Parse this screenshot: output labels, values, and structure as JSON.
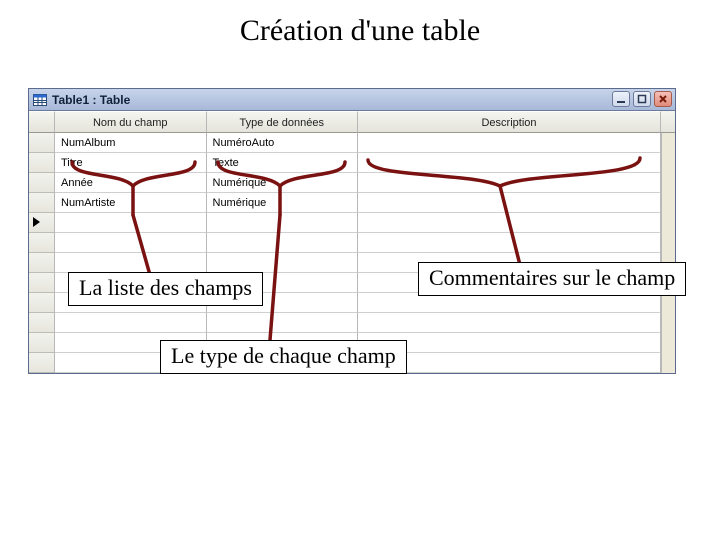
{
  "slide": {
    "title": "Création d'une table"
  },
  "window": {
    "title": "Table1 : Table"
  },
  "columns": {
    "field_name": "Nom du champ",
    "data_type": "Type de données",
    "description": "Description"
  },
  "rows": [
    {
      "name": "NumAlbum",
      "type": "NuméroAuto",
      "desc": ""
    },
    {
      "name": "Titre",
      "type": "Texte",
      "desc": ""
    },
    {
      "name": "Année",
      "type": "Numérique",
      "desc": ""
    },
    {
      "name": "NumArtiste",
      "type": "Numérique",
      "desc": ""
    }
  ],
  "callouts": {
    "fields_list": "La liste des champs",
    "type_each": "Le type de chaque champ",
    "comments": "Commentaires sur le champ"
  }
}
